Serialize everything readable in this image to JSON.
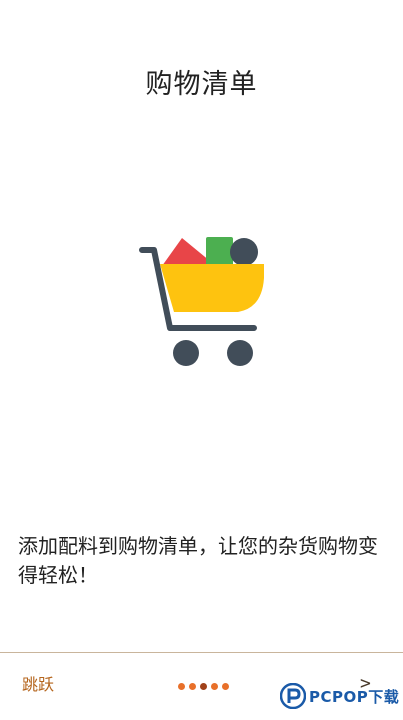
{
  "header": {
    "title": "购物清单"
  },
  "illustration": {
    "icon": "shopping-cart-icon",
    "colors": {
      "cart_basket": "#fec30f",
      "cart_frame": "#414d59",
      "item_red": "#e84548",
      "item_green": "#4caf50",
      "item_dark": "#414d59"
    }
  },
  "body": {
    "description": "添加配料到购物清单，让您的杂货购物变得轻松！"
  },
  "footer": {
    "skip_label": "跳跃",
    "next_label": ">",
    "pager": {
      "total": 5,
      "current": 3
    },
    "accent_color": "#e8702a"
  },
  "watermark": {
    "text": "PCPOP下载"
  }
}
